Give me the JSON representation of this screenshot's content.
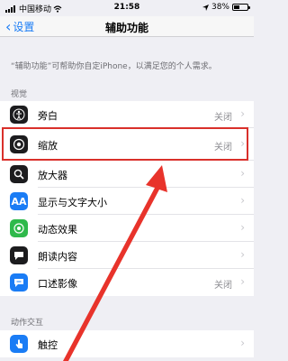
{
  "status": {
    "carrier": "中国移动",
    "time": "21:58",
    "battery": "38%"
  },
  "nav": {
    "back_label": "设置",
    "title": "辅助功能"
  },
  "description": "“辅助功能”可帮助你自定iPhone，以满足您的个人需求。",
  "sections": {
    "vision": "视觉",
    "interaction": "动作交互"
  },
  "vision_items": [
    {
      "label": "旁白",
      "value": "关闭",
      "icon": "voiceover-icon",
      "color": "#1c1c1e"
    },
    {
      "label": "缩放",
      "value": "关闭",
      "icon": "zoom-icon",
      "color": "#1c1c1e"
    },
    {
      "label": "放大器",
      "value": "",
      "icon": "magnifier-icon",
      "color": "#1c1c1e"
    },
    {
      "label": "显示与文字大小",
      "value": "",
      "icon": "text-size-icon",
      "color": "#1a7cf5",
      "glyph": "AA"
    },
    {
      "label": "动态效果",
      "value": "",
      "icon": "motion-icon",
      "color": "#2fb94b"
    },
    {
      "label": "朗读内容",
      "value": "",
      "icon": "spoken-content-icon",
      "color": "#1c1c1e"
    },
    {
      "label": "口述影像",
      "value": "关闭",
      "icon": "audio-description-icon",
      "color": "#1a7cf5"
    }
  ],
  "interaction_items": [
    {
      "label": "触控",
      "value": "",
      "icon": "touch-icon",
      "color": "#1a7cf5"
    }
  ],
  "colors": {
    "accent": "#1a7cf5",
    "highlight": "#d9302b"
  }
}
